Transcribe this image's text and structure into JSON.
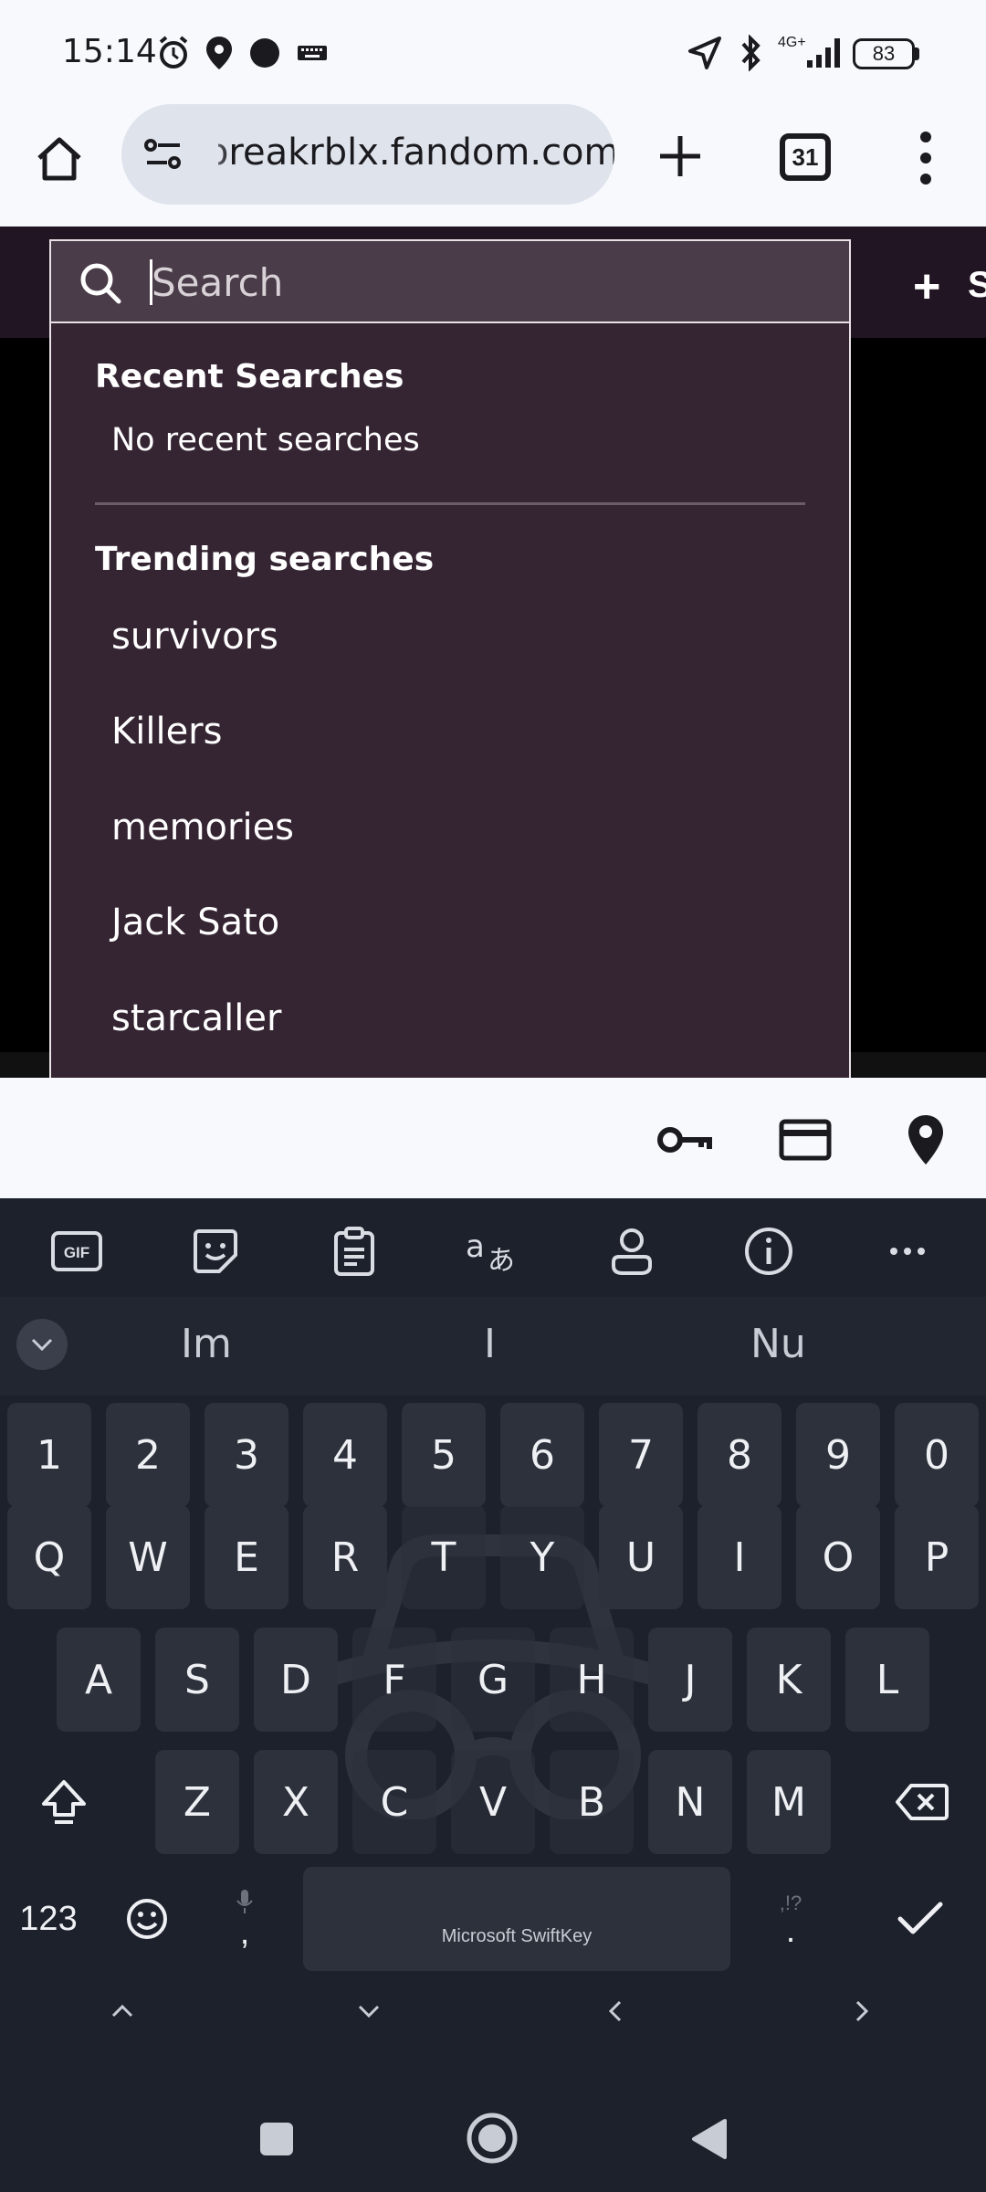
{
  "status_bar": {
    "time": "15:14",
    "network": "4G+",
    "battery": "83"
  },
  "browser": {
    "url": "breakrblx.fandom.com",
    "tab_count": "31"
  },
  "site_header": {
    "create_label": "+",
    "create_letter": "S"
  },
  "search": {
    "placeholder": "Search",
    "recent_title": "Recent Searches",
    "recent_empty": "No recent searches",
    "trending_title": "Trending searches",
    "trending": [
      "survivors",
      "Killers",
      "memories",
      "Jack Sato",
      "starcaller"
    ]
  },
  "keyboard": {
    "suggestions": [
      "Im",
      "I",
      "Nu"
    ],
    "number_row": [
      "1",
      "2",
      "3",
      "4",
      "5",
      "6",
      "7",
      "8",
      "9",
      "0"
    ],
    "row1": [
      "Q",
      "W",
      "E",
      "R",
      "T",
      "Y",
      "U",
      "I",
      "O",
      "P"
    ],
    "row2": [
      "A",
      "S",
      "D",
      "F",
      "G",
      "H",
      "J",
      "K",
      "L"
    ],
    "row3": [
      "Z",
      "X",
      "C",
      "V",
      "B",
      "N",
      "M"
    ],
    "numbers_label": "123",
    "comma": ",",
    "period": ".",
    "period_alt": ",!?",
    "space_label": "Microsoft SwiftKey"
  }
}
